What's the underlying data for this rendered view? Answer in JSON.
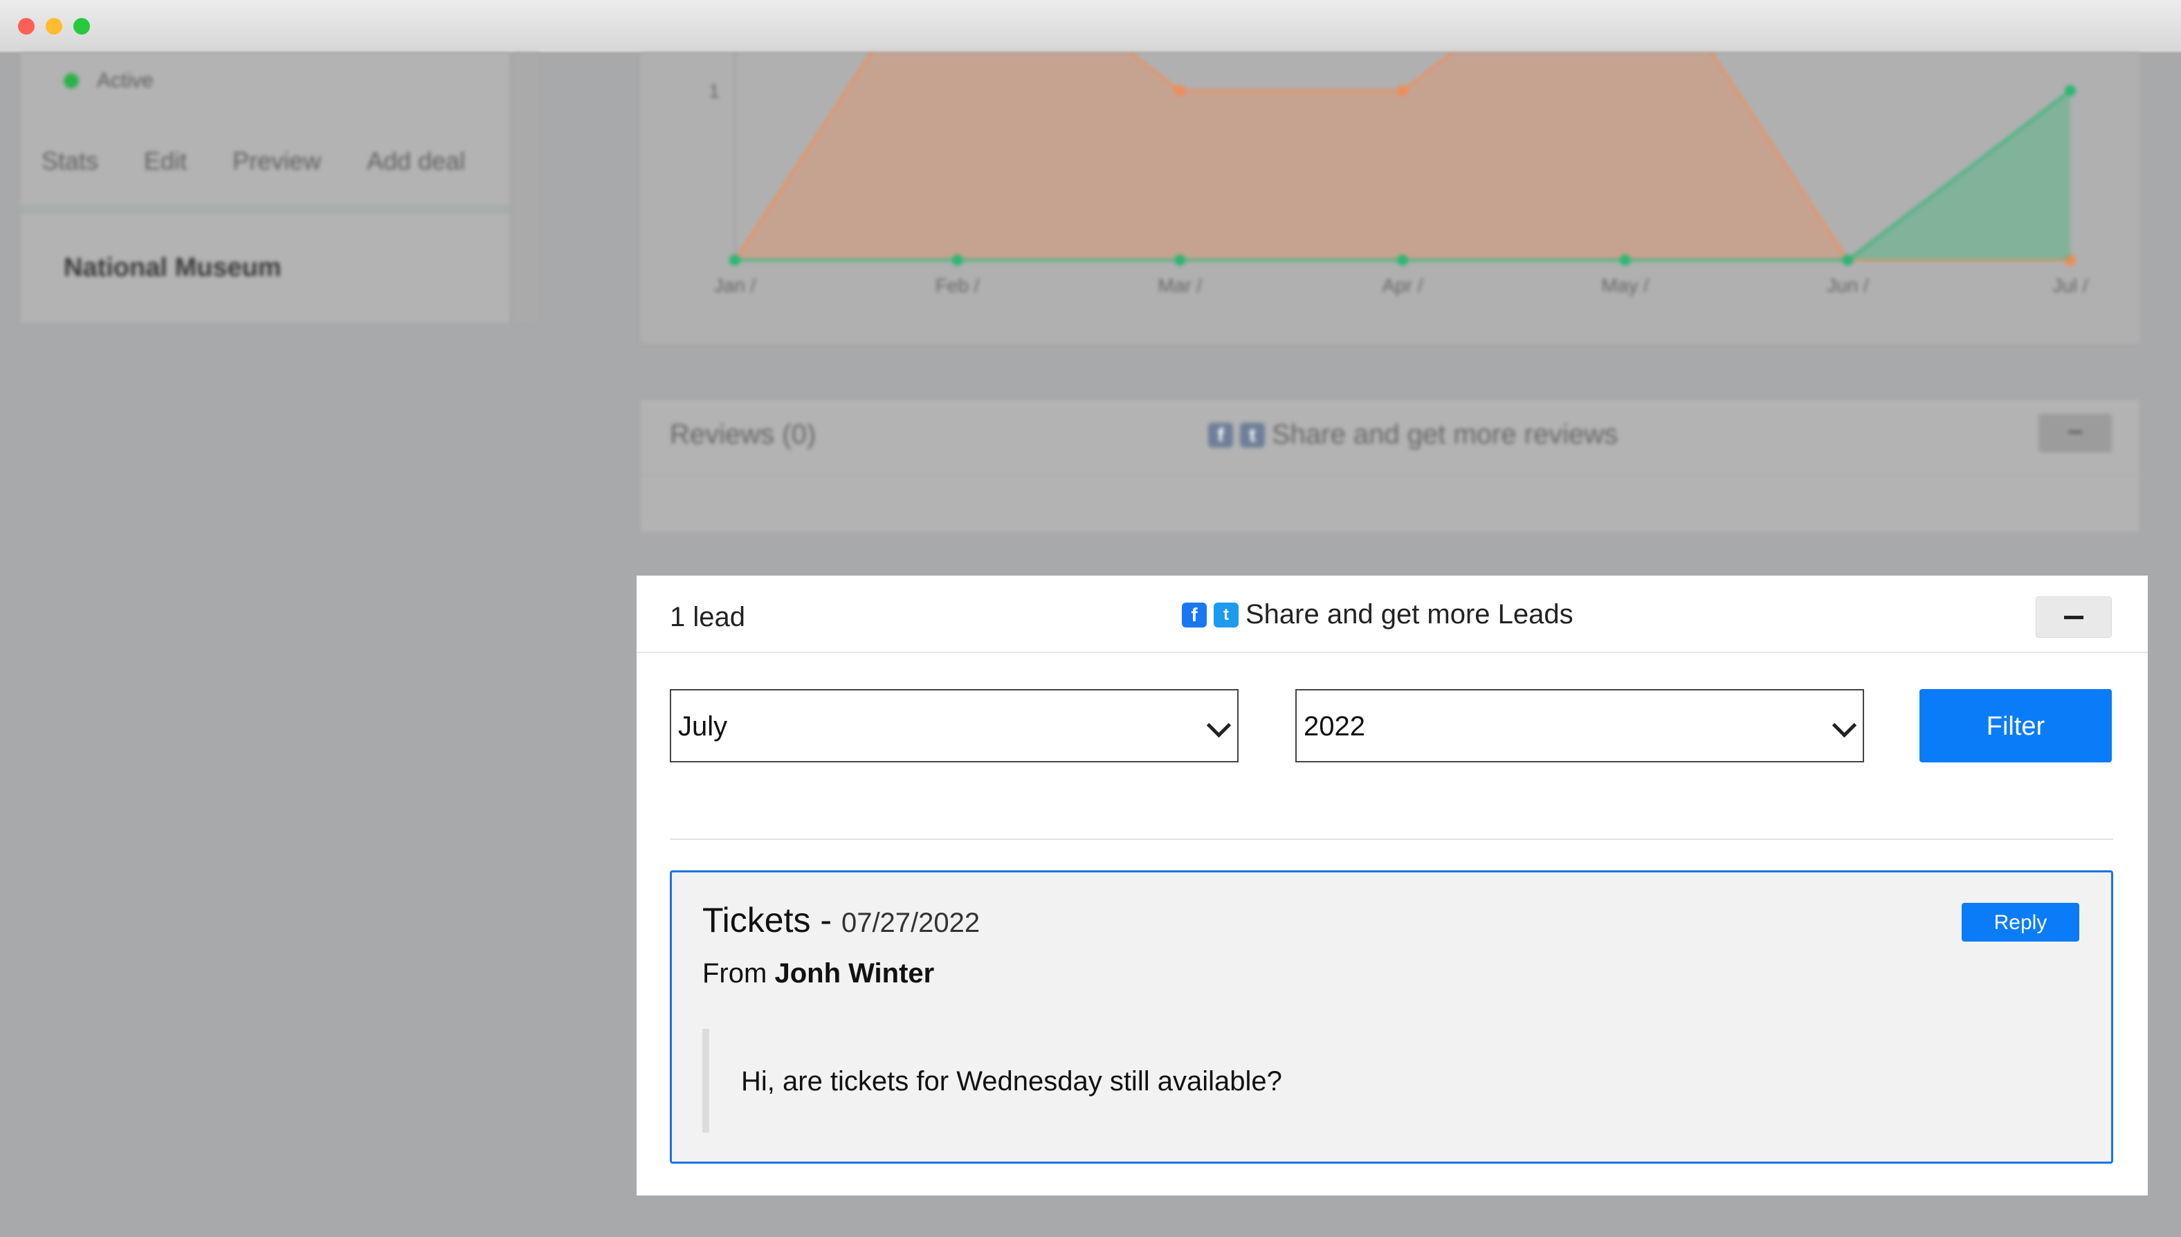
{
  "sidebar": {
    "status": "Active",
    "tabs": [
      "Stats",
      "Edit",
      "Preview",
      "Add deal"
    ],
    "museum_name": "National Museum"
  },
  "chart_data": {
    "type": "area",
    "categories": [
      "Jan /",
      "Feb /",
      "Mar /",
      "Apr /",
      "May /",
      "Jun /",
      "Jul /"
    ],
    "series": [
      {
        "values": [
          0,
          2,
          1,
          1,
          2,
          0,
          0
        ],
        "color": "#f08c5a"
      },
      {
        "values": [
          0,
          0,
          0,
          0,
          0,
          0,
          1
        ],
        "color": "#2bb673"
      }
    ],
    "ytick_labels": [
      "1"
    ],
    "ylim": [
      0,
      2
    ]
  },
  "reviews": {
    "title": "Reviews (0)",
    "share_text": "Share and get more reviews",
    "toggle": "−"
  },
  "leads": {
    "count_label": "1 lead",
    "share_text": "Share and get more Leads",
    "toggle_icon": "minus-icon",
    "month": {
      "selected": "July"
    },
    "year": {
      "selected": "2022"
    },
    "filter_label": "Filter",
    "items": [
      {
        "subject": "Tickets -",
        "date": "07/27/2022",
        "from_prefix": "From",
        "from_name": "Jonh Winter",
        "reply_label": "Reply",
        "message": "Hi, are tickets for Wednesday still available?"
      }
    ]
  },
  "colors": {
    "accent": "#0a7cf7",
    "card_border": "#1a73e8",
    "facebook": "#1877f2",
    "twitter": "#1d9bf0"
  }
}
